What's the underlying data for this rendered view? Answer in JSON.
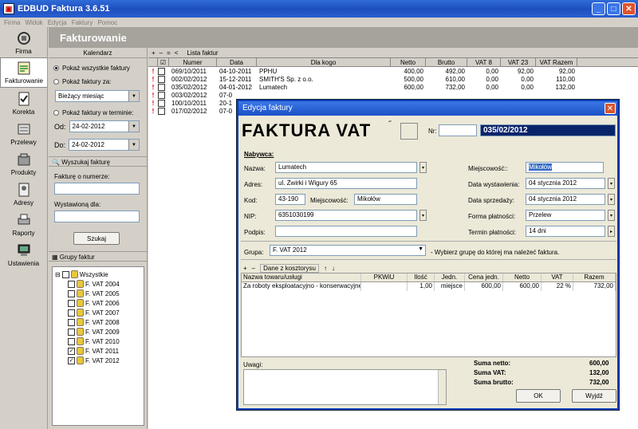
{
  "window": {
    "title": "EDBUD Faktura 3.6.51"
  },
  "menu": [
    "Firma",
    "Widok",
    "Edycja",
    "Faktury",
    "Pomoc"
  ],
  "nav": [
    "Firma",
    "Fakturowanie",
    "Korekta",
    "Przelewy",
    "Produkty",
    "Adresy",
    "Raporty",
    "Ustawienia"
  ],
  "header": {
    "title": "Fakturowanie"
  },
  "calendar": {
    "title": "Kalendarz",
    "opt_all": "Pokaż wszystkie faktury",
    "opt_for": "Pokaż faktury za:",
    "month_value": "Bieżący miesiąc",
    "opt_range": "Pokaż faktury w terminie:",
    "from_label": "Od:",
    "from_value": "24-02-2012",
    "to_label": "Do:",
    "to_value": "24-02-2012"
  },
  "search": {
    "title": "Wyszukaj fakturę",
    "number_label": "Fakturę o numerze:",
    "issued_label": "Wystawioną dla:",
    "button": "Szukaj"
  },
  "groups": {
    "title": "Grupy faktur",
    "root": "Wszystkie",
    "items": [
      {
        "label": "F. VAT 2004",
        "checked": false
      },
      {
        "label": "F. VAT 2005",
        "checked": false
      },
      {
        "label": "F. VAT 2006",
        "checked": false
      },
      {
        "label": "F. VAT 2007",
        "checked": false
      },
      {
        "label": "F. VAT 2008",
        "checked": false
      },
      {
        "label": "F. VAT 2009",
        "checked": false
      },
      {
        "label": "F. VAT 2010",
        "checked": false
      },
      {
        "label": "F. VAT 2011",
        "checked": true
      },
      {
        "label": "F. VAT 2012",
        "checked": true
      }
    ]
  },
  "list": {
    "toolbar_label": "Lista faktur",
    "columns": [
      "Numer",
      "Data",
      "Dla kogo",
      "Netto",
      "Brutto",
      "VAT 8",
      "VAT 23",
      "VAT Razem"
    ],
    "rows": [
      [
        "069/10/2011",
        "04-10-2011",
        "PPHU",
        "400,00",
        "492,00",
        "0,00",
        "92,00",
        "92,00"
      ],
      [
        "002/02/2012",
        "15-12-2011",
        "SMITH'S Sp. z o.o.",
        "500,00",
        "610,00",
        "0,00",
        "0,00",
        "110,00"
      ],
      [
        "035/02/2012",
        "04-01-2012",
        "Lumatech",
        "600,00",
        "732,00",
        "0,00",
        "0,00",
        "132,00"
      ],
      [
        "003/02/2012",
        "07-0",
        "",
        "",
        "",
        "",
        "",
        ""
      ],
      [
        "100/10/2011",
        "20-1",
        "",
        "",
        "",
        "",
        "",
        ""
      ],
      [
        "017/02/2012",
        "07-0",
        "",
        "",
        "",
        "",
        "",
        ""
      ]
    ]
  },
  "dialog": {
    "title": "Edycja faktury",
    "heading": "FAKTURA VAT",
    "nr_label": "Nr:",
    "number": "035/02/2012",
    "buyer_label": "Nabywca:",
    "name_label": "Nazwa:",
    "name_value": "Lumatech",
    "addr_label": "Adres:",
    "addr_value": "ul. Żwirki i Wigury 65",
    "code_label": "Kod:",
    "code_value": "43-190",
    "city_label": "Miejscowość:",
    "city_value": "Mikołów",
    "nip_label": "NIP:",
    "nip_value": "6351030199",
    "sign_label": "Podpis:",
    "place_label": "Miejscowość::",
    "place_value": "Mikołów",
    "issue_label": "Data wystawienia:",
    "issue_value": "04 stycznia 2012",
    "sale_label": "Data sprzedaży:",
    "sale_value": "04 stycznia 2012",
    "pay_label": "Forma płatności:",
    "pay_value": "Przelew",
    "term_label": "Termin płatności:",
    "term_value": "14 dni",
    "group_label": "Grupa:",
    "group_value": "F. VAT 2012",
    "group_hint": "- Wybierz grupę do której ma należeć faktura.",
    "costs_label": "Dane z kosztorysu",
    "columns": [
      "Nazwa towaru/usługi",
      "PKWiU",
      "Ilość",
      "Jedn.",
      "Cena jedn.",
      "Netto",
      "VAT",
      "Razem"
    ],
    "items": [
      [
        "Za roboty eksploatacyjno - konserwacyjne",
        "",
        "1,00",
        "miejsce",
        "600,00",
        "600,00",
        "22 %",
        "732,00"
      ]
    ],
    "notes_label": "Uwagi:",
    "sum_net_label": "Suma netto:",
    "sum_net": "600,00",
    "sum_vat_label": "Suma VAT:",
    "sum_vat": "132,00",
    "sum_gross_label": "Suma brutto:",
    "sum_gross": "732,00",
    "ok": "OK",
    "exit": "Wyjdź"
  }
}
